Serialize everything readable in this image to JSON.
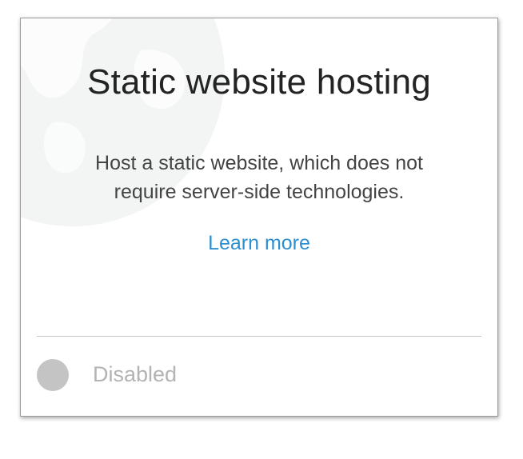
{
  "card": {
    "title": "Static website hosting",
    "description_line1": "Host a static website, which does not",
    "description_line2": "require server-side technologies.",
    "learn_more_label": "Learn more",
    "status_label": "Disabled",
    "status_enabled": false,
    "background_icon": "globe-icon"
  },
  "colors": {
    "link": "#2e8fd0",
    "title": "#232323",
    "status_disabled": "#c4c4c4",
    "globe_tint": "#f3f5f4"
  }
}
